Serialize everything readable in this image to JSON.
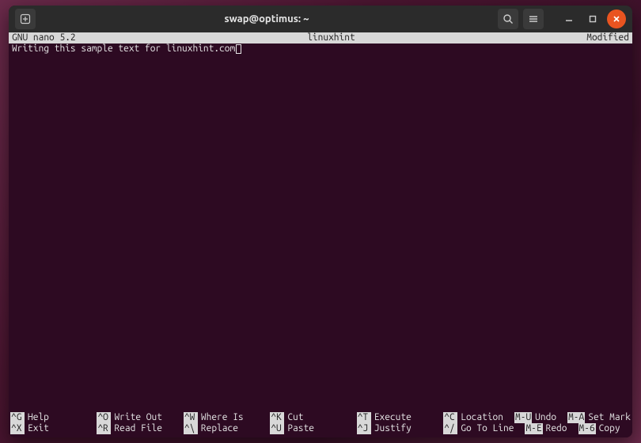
{
  "titlebar": {
    "title": "swap@optimus: ~",
    "search_icon": "search-icon",
    "menu_icon": "hamburger-icon",
    "min": "–",
    "max": "□",
    "close": "×"
  },
  "nano": {
    "app": "GNU nano 5.2",
    "filename": "linuxhint",
    "status": "Modified",
    "body_line1": "Writing this sample text for linuxhint.com"
  },
  "shortcuts": {
    "row1": [
      {
        "key": "^G",
        "label": "Help"
      },
      {
        "key": "^O",
        "label": "Write Out"
      },
      {
        "key": "^W",
        "label": "Where Is"
      },
      {
        "key": "^K",
        "label": "Cut"
      },
      {
        "key": "^T",
        "label": "Execute"
      },
      {
        "key": "^C",
        "label": "Location"
      }
    ],
    "row1b": [
      {
        "key": "M-U",
        "label": "Undo"
      },
      {
        "key": "M-A",
        "label": "Set Mark"
      }
    ],
    "row2": [
      {
        "key": "^X",
        "label": "Exit"
      },
      {
        "key": "^R",
        "label": "Read File"
      },
      {
        "key": "^\\",
        "label": "Replace"
      },
      {
        "key": "^U",
        "label": "Paste"
      },
      {
        "key": "^J",
        "label": "Justify"
      },
      {
        "key": "^/",
        "label": "Go To Line"
      }
    ],
    "row2b": [
      {
        "key": "M-E",
        "label": "Redo"
      },
      {
        "key": "M-6",
        "label": "Copy"
      }
    ]
  }
}
